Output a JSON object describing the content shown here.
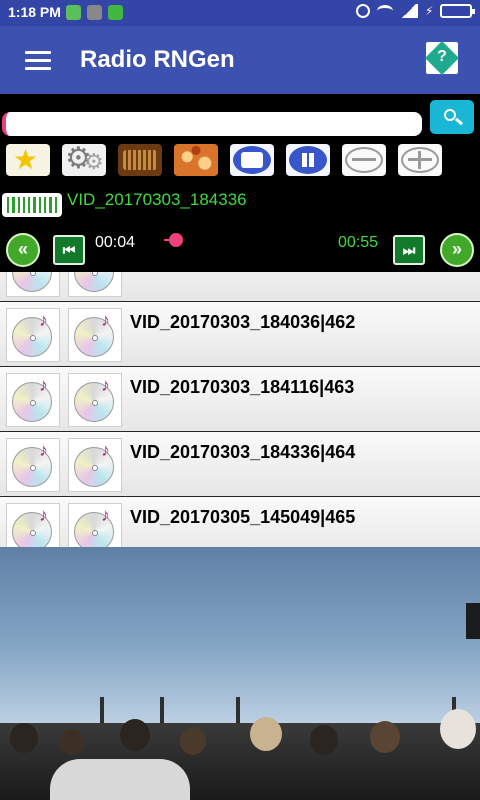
{
  "status_bar": {
    "time": "1:18 PM"
  },
  "app_bar": {
    "title": "Radio RNGen"
  },
  "search": {
    "value": "",
    "placeholder": ""
  },
  "toolbar": {
    "buttons": [
      "favorite-star",
      "settings-gears",
      "radio",
      "fractal",
      "stop",
      "pause",
      "minus",
      "plus"
    ]
  },
  "player": {
    "current_track": "VID_20170303_184336",
    "elapsed": "00:04",
    "duration": "00:55",
    "progress_fraction": 0.07
  },
  "tracks": [
    {
      "label": ""
    },
    {
      "label": "VID_20170303_184036|462"
    },
    {
      "label": "VID_20170303_184116|463"
    },
    {
      "label": "VID_20170303_184336|464"
    },
    {
      "label": "VID_20170305_145049|465"
    }
  ],
  "colors": {
    "app_bar": "#3d51b0",
    "status_bar": "#3346a8",
    "track_title": "#3ddc3d",
    "accent_pink": "#f0427a",
    "search_button": "#19b6d6"
  }
}
